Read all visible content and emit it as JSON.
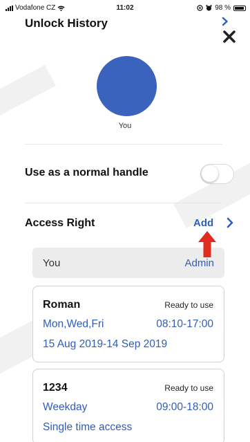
{
  "status_bar": {
    "carrier": "Vodafone CZ",
    "time": "11:02",
    "battery": "98 %"
  },
  "header": {
    "title": "Unlock History",
    "close_icon": "close-icon",
    "chevron_icon": "chevron-right-icon"
  },
  "profile": {
    "name": "You",
    "avatar_color": "#3b63be"
  },
  "normal_handle": {
    "label": "Use as a normal handle",
    "enabled": false
  },
  "access_right": {
    "title": "Access Right",
    "add_label": "Add",
    "owner": {
      "name": "You",
      "role": "Admin"
    },
    "entries": [
      {
        "name": "Roman",
        "status": "Ready to use",
        "days": "Mon,Wed,Fri",
        "time": "08:10-17:00",
        "period": "15 Aug 2019-14 Sep 2019"
      },
      {
        "name": "1234",
        "status": "Ready to use",
        "days": "Weekday",
        "time": "09:00-18:00",
        "period": "Single time access"
      }
    ]
  },
  "colors": {
    "accent": "#2f5dbc",
    "annotation_arrow": "#e02b1f"
  }
}
